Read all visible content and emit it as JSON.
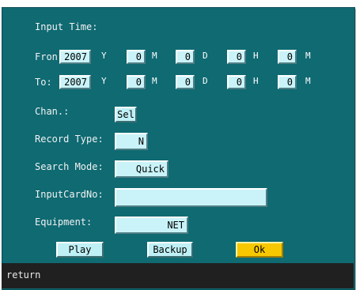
{
  "header": {
    "title": "Input Time:"
  },
  "from": {
    "label": "Fron",
    "year": "2007",
    "year_unit": "Y",
    "month": "0",
    "month_unit": "M",
    "day": "0",
    "day_unit": "D",
    "hour": "0",
    "hour_unit": "H",
    "minute": "0",
    "minute_unit": "M"
  },
  "to": {
    "label": "To:",
    "year": "2007",
    "year_unit": "Y",
    "month": "0",
    "month_unit": "M",
    "day": "0",
    "day_unit": "D",
    "hour": "0",
    "hour_unit": "H",
    "minute": "0",
    "minute_unit": "M"
  },
  "channel": {
    "label": "Chan.:",
    "button": "Sel"
  },
  "record_type": {
    "label": "Record Type:",
    "value": "N"
  },
  "search_mode": {
    "label": "Search Mode:",
    "value": "Quick"
  },
  "input_card": {
    "label": "InputCardNo:",
    "value": ""
  },
  "equipment": {
    "label": "Equipment:",
    "value": "NET"
  },
  "buttons": {
    "play": "Play",
    "backup": "Backup",
    "ok": "Ok"
  },
  "status_bar": {
    "text": "return"
  },
  "colors": {
    "panel": "#0f6a72",
    "field": "#c9f3f8",
    "ok_button": "#f7c800",
    "status_bar": "#202020"
  }
}
